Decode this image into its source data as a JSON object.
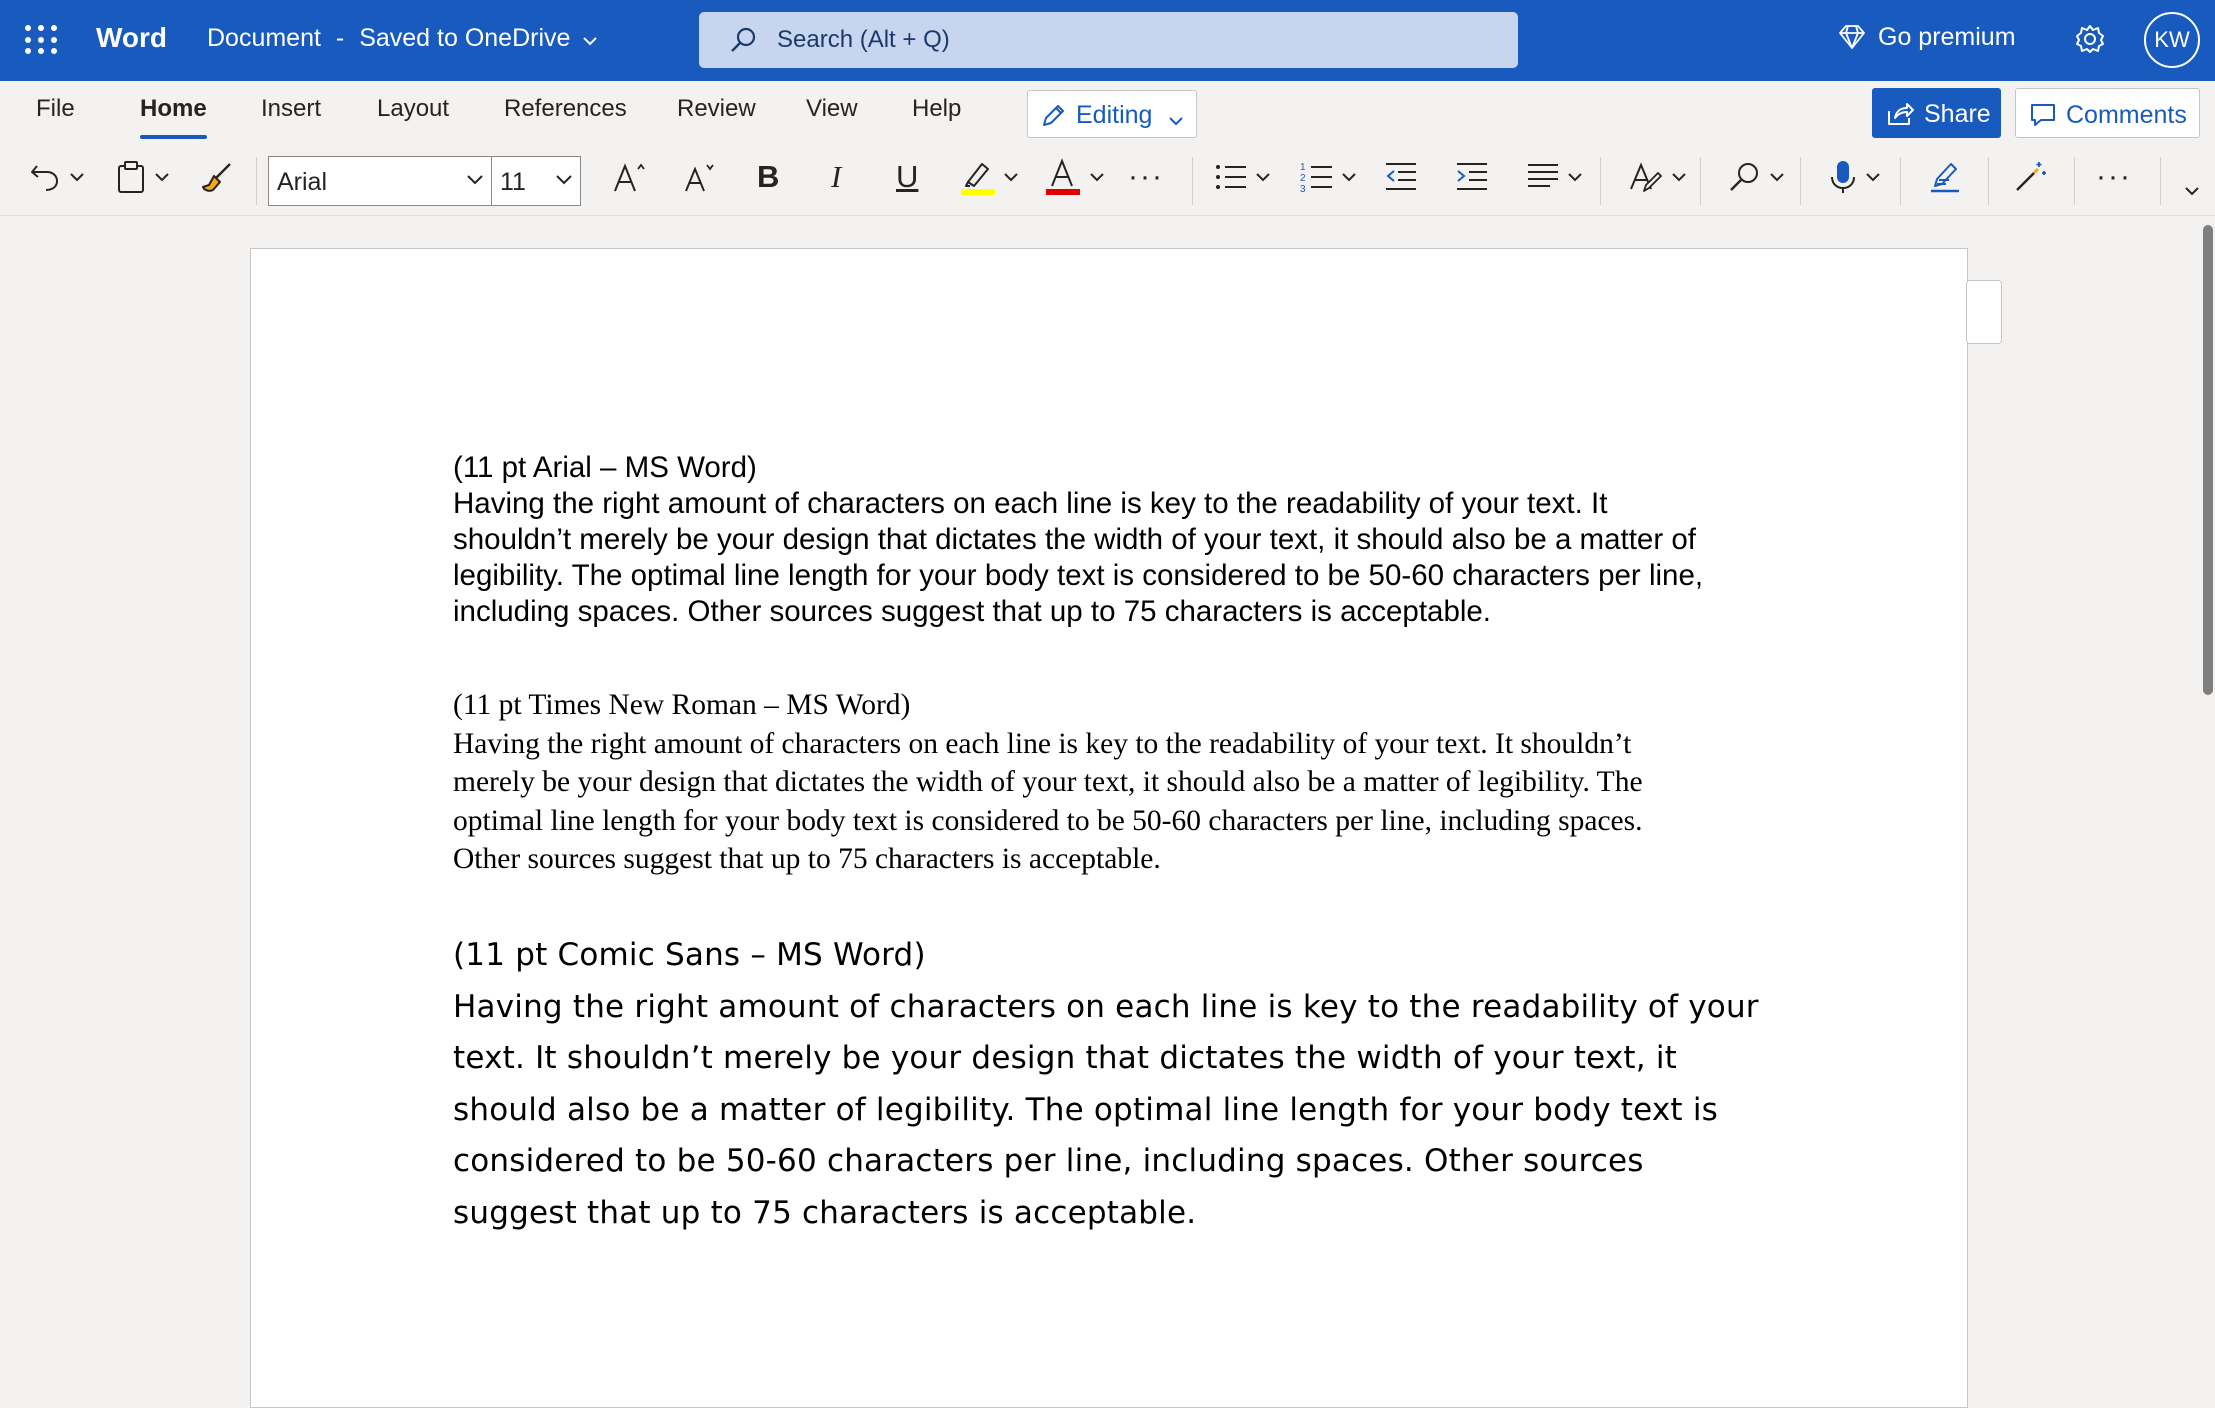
{
  "titlebar": {
    "app_name": "Word",
    "doc_title": "Document",
    "doc_sep": "-",
    "save_status": "Saved to OneDrive",
    "search_placeholder": "Search (Alt + Q)",
    "premium_label": "Go premium",
    "avatar_initials": "KW"
  },
  "ribbon": {
    "tabs": [
      "File",
      "Home",
      "Insert",
      "Layout",
      "References",
      "Review",
      "View",
      "Help"
    ],
    "active_tab": "Home",
    "editing_label": "Editing",
    "share_label": "Share",
    "comments_label": "Comments"
  },
  "toolbar": {
    "font_name": "Arial",
    "font_size": "11",
    "bold": "B",
    "italic": "I",
    "underline": "U",
    "highlight_color": "#ffff00",
    "font_color": "#e00000",
    "more": "···"
  },
  "document": {
    "sections": [
      {
        "heading": "(11 pt Arial – MS Word)",
        "lines": [
          "Having the right amount of characters on each line is key to the readability of your text. It",
          "shouldn’t merely be your design that dictates the width of your text, it should also be a matter of",
          "legibility. The optimal line length for your body text is considered to be 50-60 characters per line,",
          "including spaces. Other sources suggest that up to 75 characters is acceptable."
        ]
      },
      {
        "heading": "(11 pt Times New Roman – MS Word)",
        "lines": [
          "Having the right amount of characters on each line is key to the readability of your text. It shouldn’t",
          "merely be your design that dictates the width of your text, it should also be a matter of legibility. The",
          "optimal line length for your body text is considered to be 50-60 characters per line, including spaces.",
          "Other sources suggest that up to 75 characters is acceptable."
        ]
      },
      {
        "heading": "(11 pt Comic Sans – MS Word)",
        "lines": [
          "Having the right amount of characters on each line is key to the readability of your",
          "text. It shouldn’t merely be your design that dictates the width of your text, it",
          "should also be a matter of legibility. The optimal line length for your body text is",
          "considered to be 50-60 characters per line, including spaces. Other sources",
          "suggest that up to 75 characters is acceptable."
        ]
      }
    ]
  },
  "colors": {
    "brand": "#185abd",
    "search_bg": "#c7d6ee",
    "ribbon_bg": "#f3f2f1"
  }
}
